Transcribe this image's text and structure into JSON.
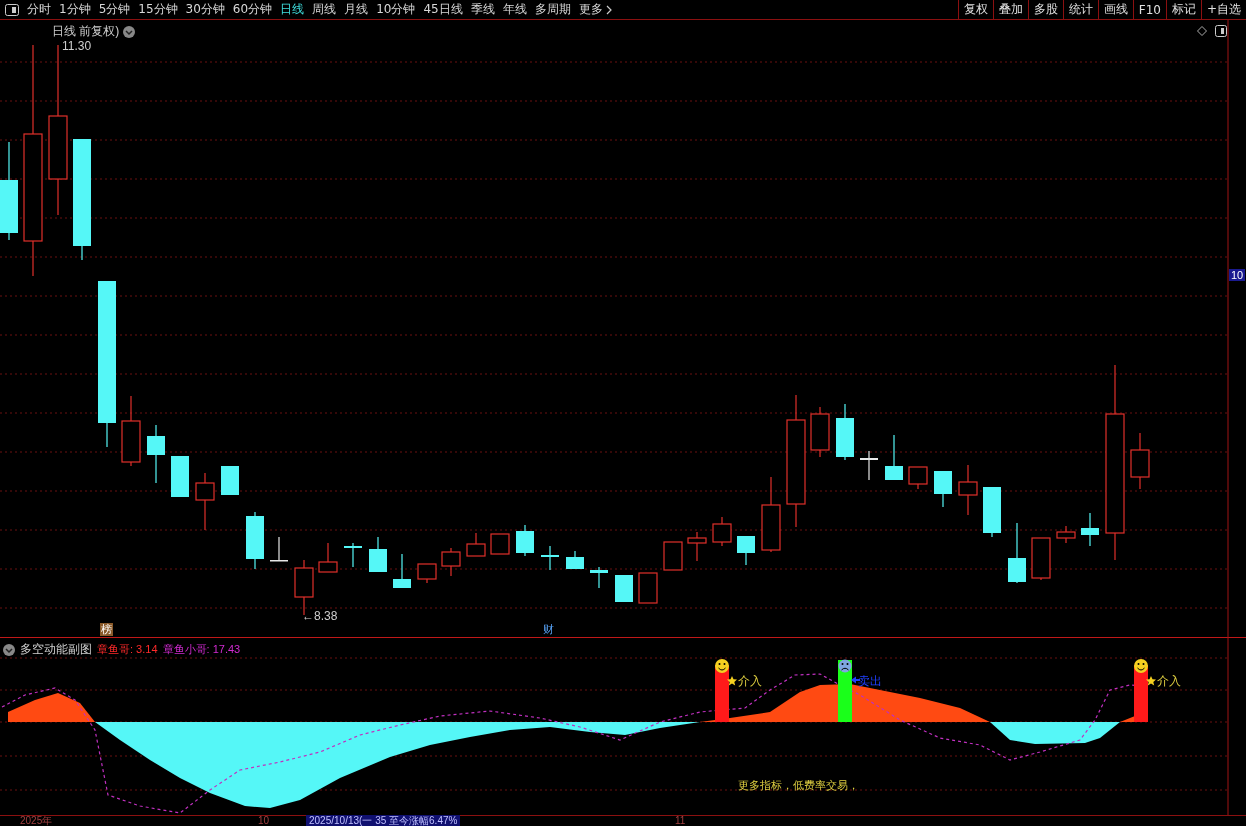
{
  "toolbar": {
    "tabs": [
      {
        "label": "分时",
        "selected": false
      },
      {
        "label": "1分钟",
        "selected": false
      },
      {
        "label": "5分钟",
        "selected": false
      },
      {
        "label": "15分钟",
        "selected": false
      },
      {
        "label": "30分钟",
        "selected": false
      },
      {
        "label": "60分钟",
        "selected": false
      },
      {
        "label": "日线",
        "selected": true
      },
      {
        "label": "周线",
        "selected": false
      },
      {
        "label": "月线",
        "selected": false
      },
      {
        "label": "10分钟",
        "selected": false
      },
      {
        "label": "45日线",
        "selected": false
      },
      {
        "label": "季线",
        "selected": false
      },
      {
        "label": "年线",
        "selected": false
      },
      {
        "label": "多周期",
        "selected": false
      }
    ],
    "more": "更多",
    "actions": [
      "复权",
      "叠加",
      "多股",
      "统计",
      "画线",
      "F10",
      "标记",
      "+自选"
    ]
  },
  "chart": {
    "title": "日线 前复权)",
    "high_label": "11.30",
    "low_label": "←8.38",
    "axis_price": "10",
    "markers": [
      {
        "kind": "rank",
        "label": "榜"
      },
      {
        "kind": "finance",
        "label": "财"
      }
    ]
  },
  "indicator": {
    "title": "多空动能副图",
    "values": [
      {
        "name": "章鱼哥:",
        "value": "3.14",
        "color": "#ff2a2a"
      },
      {
        "name": "章鱼小哥:",
        "value": "17.43",
        "color": "#d22ad2"
      }
    ],
    "signals": [
      {
        "kind": "buy",
        "label": "介入"
      },
      {
        "kind": "sell",
        "label": "卖出"
      },
      {
        "kind": "buy",
        "label": "介入"
      }
    ],
    "note": "更多指标，低费率交易，"
  },
  "time_axis": {
    "labels": [
      "2025年",
      "10",
      "11"
    ],
    "highlight": "2025/10/13(一 35 至今涨幅6.47%"
  }
}
